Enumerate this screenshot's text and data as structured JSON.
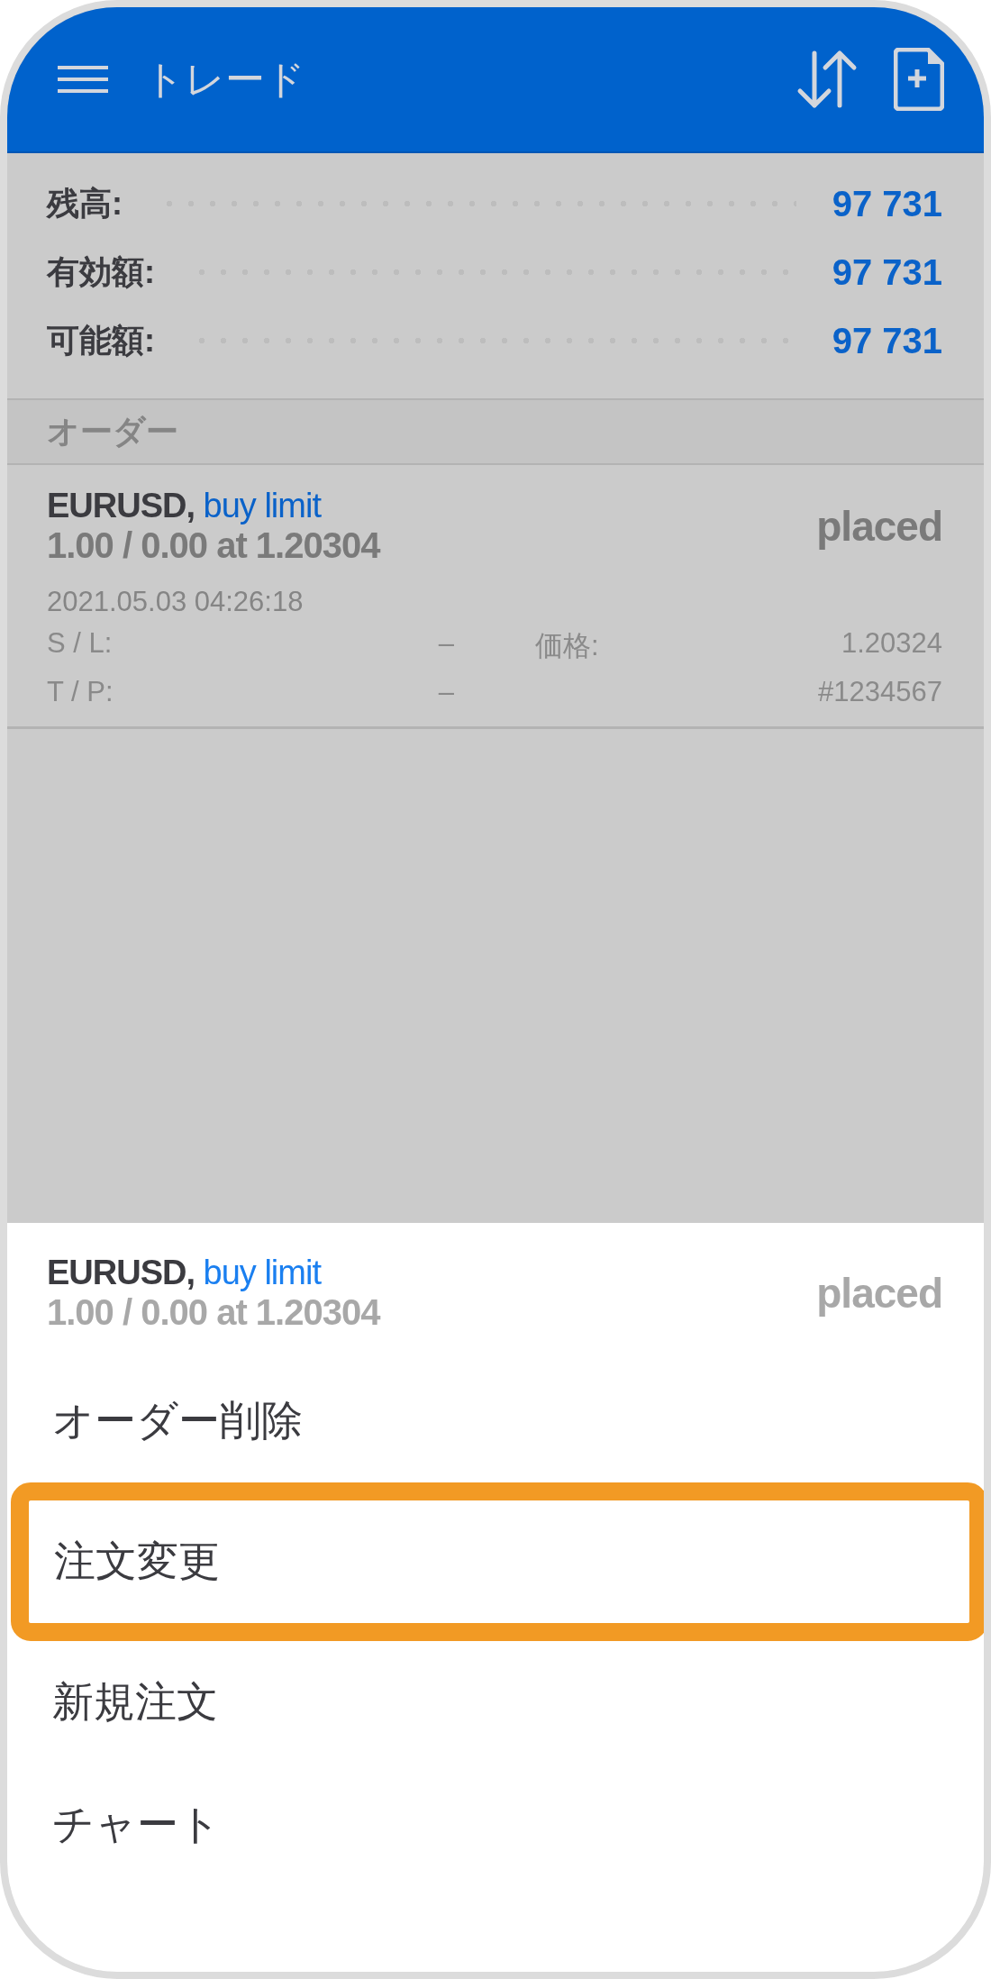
{
  "header": {
    "title": "トレード"
  },
  "balances": [
    {
      "label": "残高:",
      "value": "97 731"
    },
    {
      "label": "有効額:",
      "value": "97 731"
    },
    {
      "label": "可能額:",
      "value": "97 731"
    }
  ],
  "orders_section": {
    "title": "オーダー"
  },
  "order": {
    "symbol": "EURUSD,",
    "type": "buy limit",
    "volume": "1.00 / 0.00 at 1.20304",
    "status": "placed",
    "time": "2021.05.03 04:26:18",
    "details": [
      {
        "label": "S / L:",
        "value": "–",
        "label_2": "価格:",
        "value_2": "1.20324"
      },
      {
        "label": "T / P:",
        "value": "–",
        "value_2": "#1234567"
      }
    ]
  },
  "sheet": {
    "symbol": "EURUSD,",
    "type": "buy limit",
    "volume": "1.00 / 0.00 at 1.20304",
    "status": "placed",
    "items": [
      {
        "label": "オーダー削除",
        "highlighted": false
      },
      {
        "label": "注文変更",
        "highlighted": true
      },
      {
        "label": "新規注文",
        "highlighted": false
      },
      {
        "label": "チャート",
        "highlighted": false
      }
    ]
  }
}
